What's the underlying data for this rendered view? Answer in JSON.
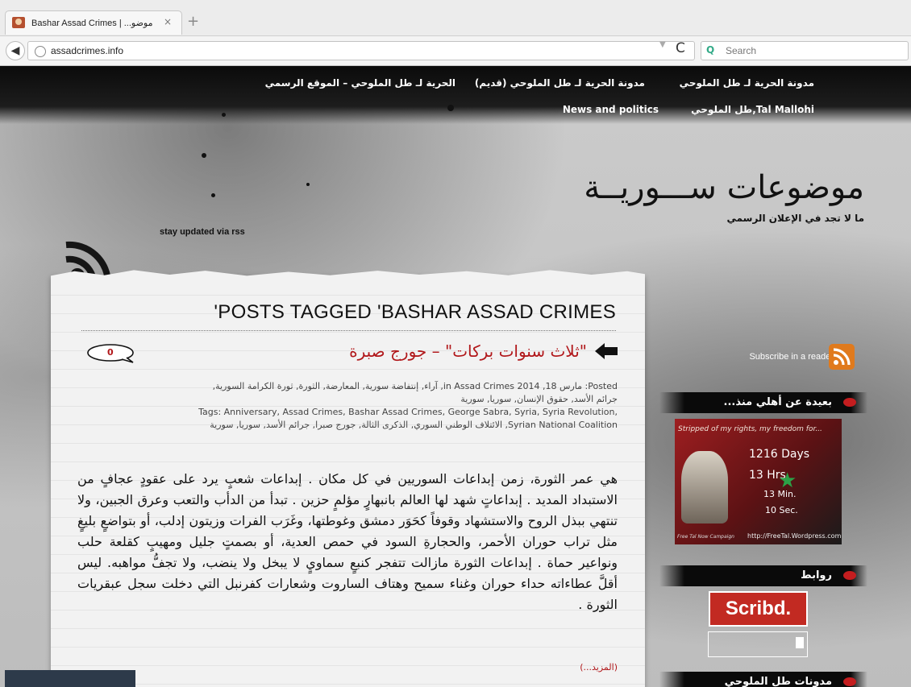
{
  "browser": {
    "tab_title": "Bashar Assad Crimes | ...موضو",
    "tab_close": "×",
    "new_tab": "+",
    "url": "assadcrimes.info",
    "search_placeholder": "Search",
    "back_glyph": "◀",
    "reload_glyph": "C"
  },
  "topnav": {
    "items": [
      "مدونة الحرية لـ طل الملوحي",
      "مدونة الحرية لـ طل الملوحي (قديم)",
      "الحرية لـ طل الملوحي – الموقع الرسمي",
      "طل الملوحي,Tal Mallohi",
      "News and politics"
    ]
  },
  "site": {
    "title": "موضوعات ســـوريــة",
    "tagline": "ما لا تجد في الإعلان الرسمي",
    "rss_label": "stay updated via rss"
  },
  "main": {
    "tagged_heading": "'POSTS TAGGED 'BASHAR ASSAD CRIMES",
    "post_title": "\"ثلاث سنوات بركات\" – جورج صبرة",
    "comment_count": "0",
    "meta_line1": "Posted: مارس 18, 2014 in Assad Crimes, آراء, إنتفاضة سورية, المعارضة, الثورة, ثورة الكرامة السورية, جرائم الأسد, حقوق الإنسان, سوريا, سورية",
    "meta_line2": "Tags: Anniversary, Assad Crimes, Bashar Assad Crimes, George Sabra, Syria, Syria Revolution, Syrian National Coalition, الائتلاف الوطني السوري, الذكرى الثالة, جورج صبرا, جرائم الأسد, سوريا, سورية",
    "body": "هي عمر الثورة، زمن إبداعات السوريين في كل مكان . إبداعات شعبٍ يرد على عقودٍ عجافٍ من الاستبداد المديد . إبداعاتٍ شهد لها العالم بانبهارٍ مؤلمٍ حزين . تبدأ من الدأب والتعب وعرق الجبين، ولا تنتهي ببذل الروح والاستشهاد وقوفاً كحَوَر دمشق وغوطتها، وغَرَب الفرات وزيتون إدلب، أو بتواضعٍ بليغٍ مثل تراب حوران الأحمر، والحجارةِ السود في حمص العدية، أو بصمتٍ جليل ومهيبٍ كقلعة حلب ونواعير حماة . إبداعات الثورة مازالت تتفجر كنبعٍ سماويٍ لا يبخل ولا ينضب، ولا تجفُّ مواهبه. ليس أقلَّ عطاءاته حداء حوران وغناء سميح وهتاف الساروت وشعارات كفرنبل التي دخلت سجل عبقريات الثورة .",
    "more_link": "(المزيد...)"
  },
  "sidebar": {
    "subscribe": "Subscribe in a reader",
    "section1_title": "بعيدة عن أهلي منذ...",
    "counter": {
      "caption": "Stripped of my rights, my freedom for...",
      "days": "1216  Days",
      "hours": "13      Hrs.",
      "minutes": "13        Min.",
      "seconds": "10        Sec.",
      "footer": "http://FreeTal.Wordpress.com",
      "footer_left": "Free Tal Now Campaign"
    },
    "section2_title": "روابط",
    "scribd": "Scribd.",
    "section3_title": "مدونات طل الملوحي"
  },
  "colors": {
    "accent_red": "#b1171a",
    "rss_orange": "#e07a1d",
    "nav_black": "#0b0b0b"
  }
}
